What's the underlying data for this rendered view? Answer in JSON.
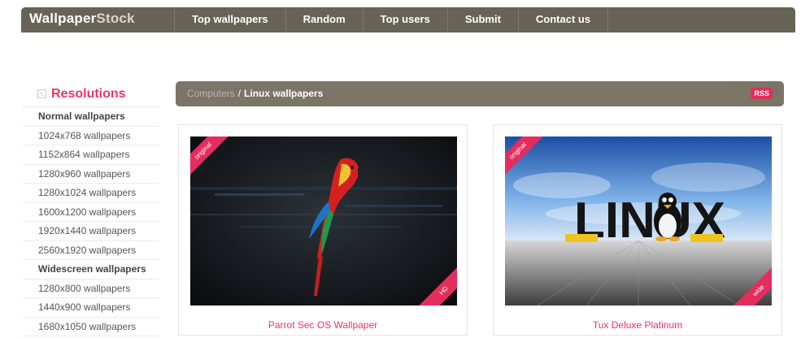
{
  "header": {
    "logo_a": "Wallpaper",
    "logo_b": "Stock",
    "nav": [
      "Top wallpapers",
      "Random",
      "Top users",
      "Submit",
      "Contact us"
    ]
  },
  "sidebar": {
    "title": "Resolutions",
    "items": [
      {
        "label": "Normal wallpapers",
        "header": true
      },
      {
        "label": "1024x768 wallpapers"
      },
      {
        "label": "1152x864 wallpapers"
      },
      {
        "label": "1280x960 wallpapers"
      },
      {
        "label": "1280x1024 wallpapers"
      },
      {
        "label": "1600x1200 wallpapers"
      },
      {
        "label": "1920x1440 wallpapers"
      },
      {
        "label": "2560x1920 wallpapers"
      },
      {
        "label": "Widescreen wallpapers",
        "header": true
      },
      {
        "label": "1280x800 wallpapers"
      },
      {
        "label": "1440x900 wallpapers"
      },
      {
        "label": "1680x1050 wallpapers"
      }
    ]
  },
  "breadcrumb": {
    "parent": "Computers",
    "separator": "/",
    "current": "Linux wallpapers",
    "rss": "RSS"
  },
  "wallpapers": [
    {
      "title": "Parrot Sec OS Wallpaper",
      "badge_top": "original",
      "badge_bottom": "HD"
    },
    {
      "title": "Tux Deluxe Platinum",
      "badge_top": "original",
      "badge_bottom": "wide",
      "image_text": "LINUX"
    }
  ],
  "colors": {
    "nav_bg": "#676356",
    "breadcrumb_bg": "#7a7566",
    "accent": "#e83662",
    "badge": "#e42d5d"
  }
}
